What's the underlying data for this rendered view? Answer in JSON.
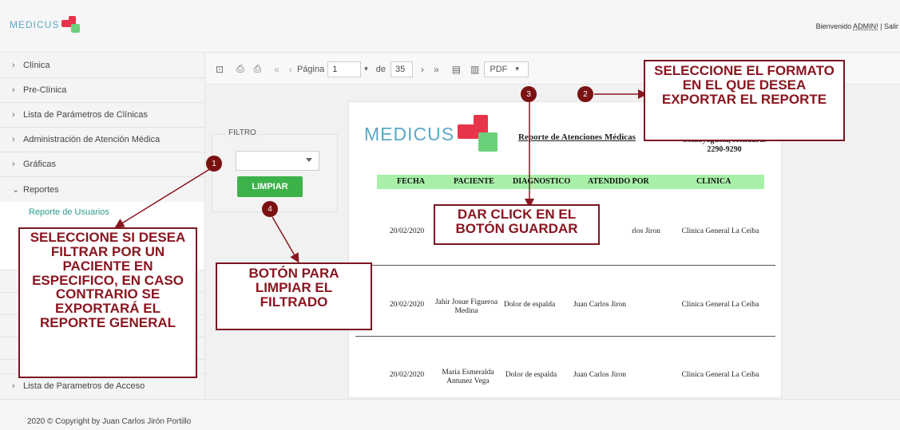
{
  "header": {
    "logo_text": "MEDICUS",
    "welcome_prefix": "Bienvenido ",
    "user": "ADMIN!",
    "logout": " | Salir"
  },
  "sidebar": {
    "items": [
      {
        "label": "Clínica",
        "chevron": "›"
      },
      {
        "label": "Pre-Clínica",
        "chevron": "›"
      },
      {
        "label": "Lista de Parámetros de Clínicas",
        "chevron": "›"
      },
      {
        "label": "Administración de Atención Médica",
        "chevron": "›"
      },
      {
        "label": "Gráficas",
        "chevron": "›"
      },
      {
        "label": "Reportes",
        "chevron": "⌄"
      }
    ],
    "sub_item": "Reporte de Usuarios",
    "bottom_item": "Lista de Parametros de Acceso"
  },
  "toolbar": {
    "page_label": "Página",
    "page_value": "1",
    "of_label": "de",
    "total_pages": "35",
    "format": "PDF"
  },
  "filter": {
    "legend": "FILTRO",
    "button": "LIMPIAR"
  },
  "report": {
    "logo_text": "MEDICUS",
    "title": "Reporte de Atenciones Médicas",
    "address_line1": "Comayagüela, Honduras",
    "address_line2": "2290-9290",
    "columns": [
      "FECHA",
      "PACIENTE",
      "DIAGNOSTICO",
      "ATENDIDO POR",
      "CLINICA"
    ],
    "rows": [
      {
        "fecha": "20/02/2020",
        "paciente": "",
        "diagnostico": "",
        "atendido": "rlos Jiron",
        "clinica": "Clinica General La Ceiba"
      },
      {
        "fecha": "20/02/2020",
        "paciente": "Jahir Josue Figueroa Medina",
        "diagnostico": "Dolor de espalda",
        "atendido": "Juan Carlos Jiron",
        "clinica": "Clinica General La Ceiba"
      },
      {
        "fecha": "20/02/2020",
        "paciente": "Maria Esmeralda Antunez Vega",
        "diagnostico": "Dolor de espalda",
        "atendido": "Juan Carlos Jiron",
        "clinica": "Clinica General La Ceiba"
      }
    ]
  },
  "callouts": {
    "c1": "SELECCIONE SI DESEA FILTRAR POR UN PACIENTE EN ESPECIFICO, EN CASO CONTRARIO SE EXPORTARÁ EL REPORTE GENERAL",
    "c2": "SELECCIONE EL FORMATO EN EL QUE DESEA EXPORTAR EL REPORTE",
    "c3": "DAR CLICK EN EL BOTÓN GUARDAR",
    "c4": "BOTÓN PARA LIMPIAR EL FILTRADO",
    "badges": [
      "1",
      "2",
      "3",
      "4"
    ]
  },
  "footer": {
    "copyright": "2020 © Copyright by Juan Carlos Jirón Portillo"
  },
  "colors": {
    "accent_green": "#3cb34a",
    "callout_red": "#8a1620",
    "header_green": "#a8f0a8",
    "logo_blue": "#5aa9c8"
  }
}
